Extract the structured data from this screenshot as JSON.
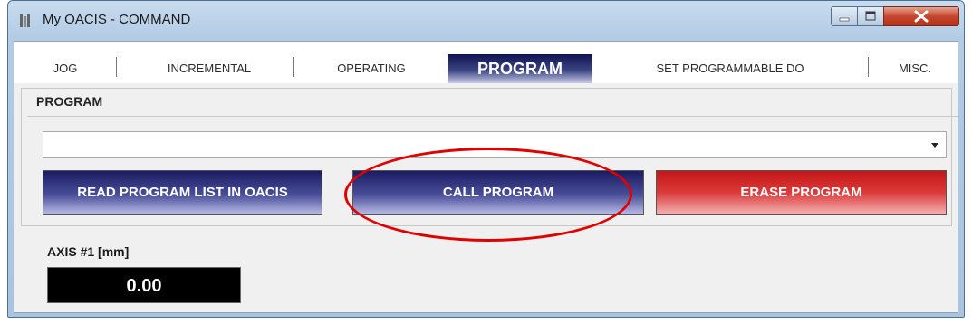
{
  "window": {
    "title": "My OACIS - COMMAND",
    "controls": {
      "minimize": "minimize-icon",
      "maximize": "maximize-icon",
      "close": "close-icon"
    }
  },
  "tabs": [
    {
      "label": "JOG"
    },
    {
      "label": "INCREMENTAL"
    },
    {
      "label": "OPERATING"
    },
    {
      "label": "PROGRAM"
    },
    {
      "label": "SET PROGRAMMABLE DO"
    },
    {
      "label": "MISC."
    }
  ],
  "active_tab": "PROGRAM",
  "program_section": {
    "title": "PROGRAM",
    "select": {
      "value": ""
    },
    "buttons": {
      "read": "READ PROGRAM LIST IN OACIS",
      "call": "CALL PROGRAM",
      "erase": "ERASE PROGRAM"
    }
  },
  "axis": {
    "label": "AXIS #1 [mm]",
    "value": "0.00"
  },
  "colors": {
    "accent_dark": "#1b1b61",
    "erase_red": "#c41616",
    "annotation_red": "#e00000",
    "value_bg": "#000000"
  }
}
